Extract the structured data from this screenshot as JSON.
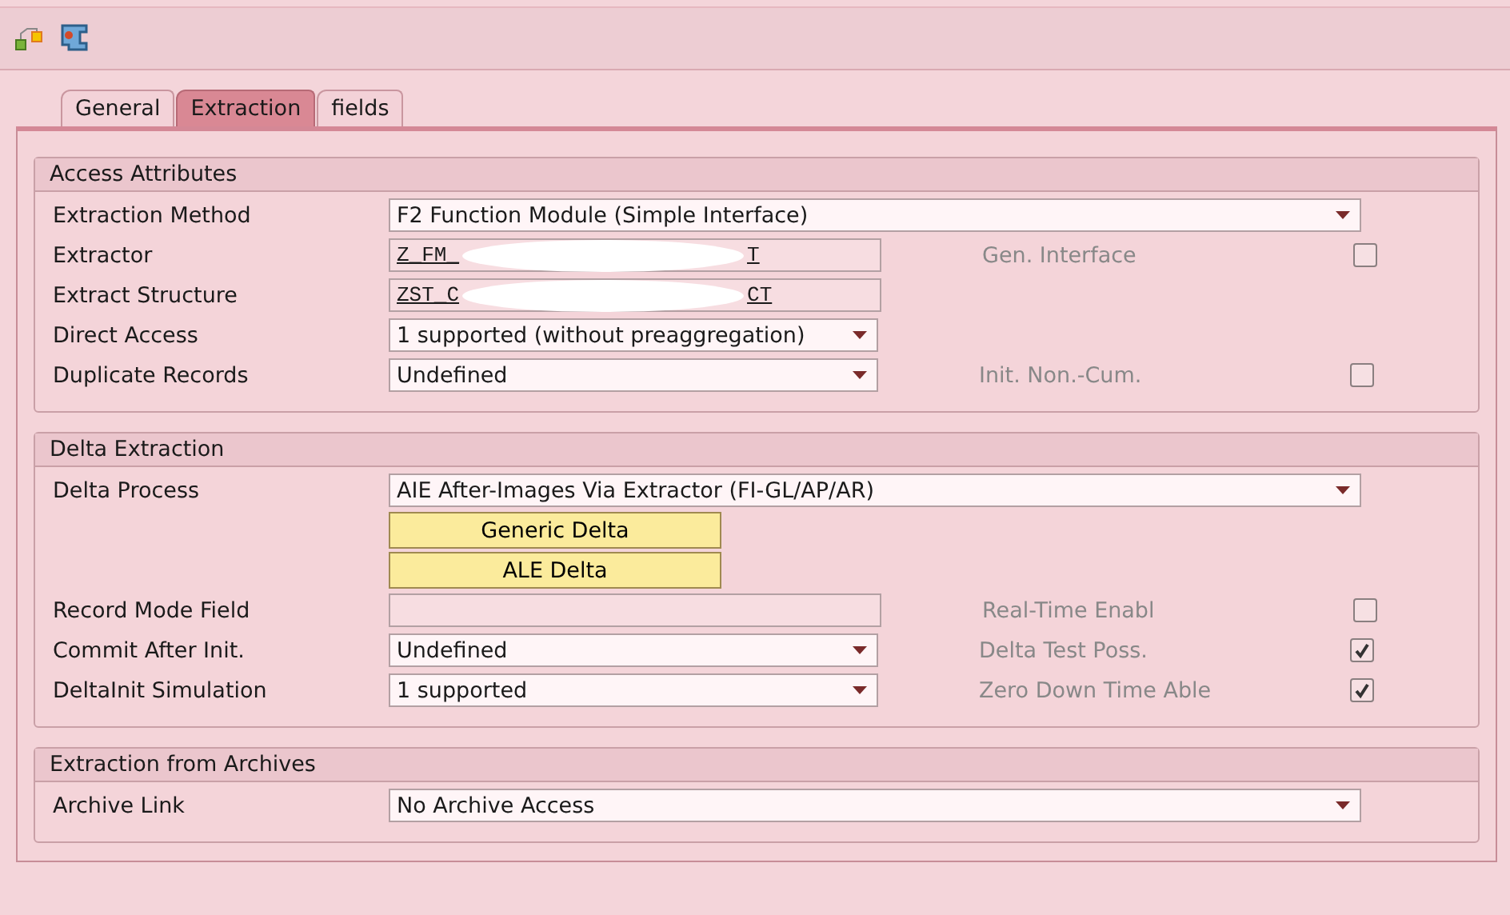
{
  "tabs": [
    {
      "label": "General",
      "selected": false
    },
    {
      "label": "Extraction",
      "selected": true
    },
    {
      "label": "fields",
      "selected": false
    }
  ],
  "groups": [
    {
      "title": "Access Attributes",
      "rows": [
        {
          "label": "Extraction Method",
          "control": {
            "kind": "dropdown",
            "wide": true,
            "value": "F2 Function Module (Simple Interface)"
          }
        },
        {
          "label": "Extractor",
          "control": {
            "kind": "redacted",
            "value_start": "Z_FM_",
            "value_end": "T"
          },
          "side": {
            "label": "Gen. Interface",
            "checked": false
          }
        },
        {
          "label": "Extract Structure",
          "control": {
            "kind": "redacted",
            "value_start": "ZST_C",
            "value_end": "CT"
          }
        },
        {
          "label": "Direct Access",
          "control": {
            "kind": "dropdown",
            "wide": false,
            "value": "1 supported (without preaggregation)"
          }
        },
        {
          "label": "Duplicate Records",
          "control": {
            "kind": "dropdown",
            "wide": false,
            "value": "Undefined"
          },
          "side": {
            "label": "Init. Non.-Cum.",
            "checked": false
          }
        }
      ]
    },
    {
      "title": "Delta Extraction",
      "rows": [
        {
          "label": "Delta Process",
          "control": {
            "kind": "dropdown",
            "wide": true,
            "value": "AIE After-Images Via Extractor (FI-GL/AP/AR)"
          }
        },
        {
          "control": {
            "kind": "button",
            "value": "Generic Delta"
          }
        },
        {
          "control": {
            "kind": "button",
            "value": "ALE Delta"
          }
        },
        {
          "label": "Record Mode Field",
          "control": {
            "kind": "text"
          },
          "side": {
            "label": "Real-Time Enabl",
            "checked": false
          }
        },
        {
          "label": "Commit After Init.",
          "control": {
            "kind": "dropdown",
            "wide": false,
            "value": "Undefined"
          },
          "side": {
            "label": "Delta Test Poss.",
            "checked": true
          }
        },
        {
          "label": "DeltaInit Simulation",
          "control": {
            "kind": "dropdown",
            "wide": false,
            "value": "1 supported"
          },
          "side": {
            "label": "Zero Down Time Able",
            "checked": true
          }
        }
      ]
    },
    {
      "title": "Extraction from Archives",
      "rows": [
        {
          "label": "Archive Link",
          "control": {
            "kind": "dropdown",
            "wide": true,
            "value": "No Archive Access"
          }
        }
      ]
    }
  ]
}
